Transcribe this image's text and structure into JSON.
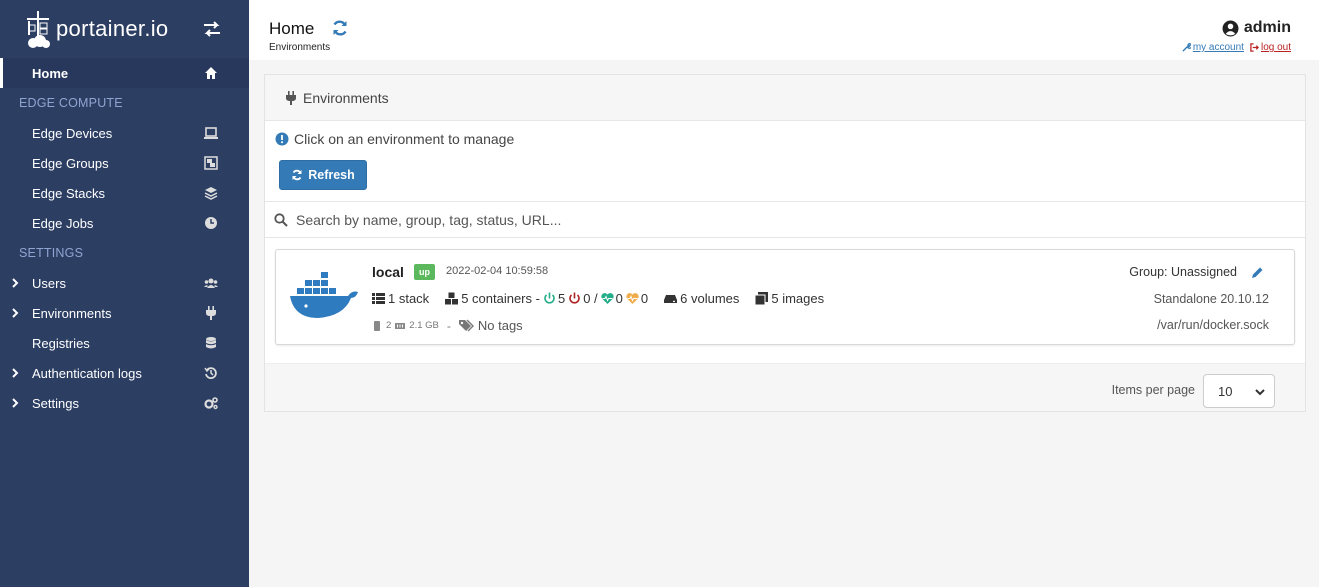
{
  "app": {
    "brand": "portainer.io",
    "accent_color": "#337ab7",
    "sidebar_color": "#2d3e63"
  },
  "sidebar": {
    "home": "Home",
    "edge_header": "EDGE COMPUTE",
    "edge_items": [
      {
        "label": "Edge Devices",
        "icon": "laptop-icon"
      },
      {
        "label": "Edge Groups",
        "icon": "object-group-icon"
      },
      {
        "label": "Edge Stacks",
        "icon": "layers-icon"
      },
      {
        "label": "Edge Jobs",
        "icon": "clock-icon"
      }
    ],
    "settings_header": "SETTINGS",
    "settings_items": [
      {
        "label": "Users",
        "icon": "users-icon",
        "expandable": true
      },
      {
        "label": "Environments",
        "icon": "plug-icon",
        "expandable": true
      },
      {
        "label": "Registries",
        "icon": "database-icon",
        "expandable": false
      },
      {
        "label": "Authentication logs",
        "icon": "history-icon",
        "expandable": true
      },
      {
        "label": "Settings",
        "icon": "cogs-icon",
        "expandable": true
      }
    ]
  },
  "header": {
    "title": "Home",
    "breadcrumb": "Environments",
    "user": "admin",
    "my_account": "my account",
    "log_out": "log out"
  },
  "panel": {
    "title": "Environments",
    "info": "Click on an environment to manage",
    "refresh_label": "Refresh",
    "search_placeholder": "Search by name, group, tag, status, URL..."
  },
  "environment": {
    "name": "local",
    "status": "up",
    "timestamp": "2022-02-04 10:59:58",
    "stacks": "1 stack",
    "containers": "5 containers -",
    "running": "5",
    "stopped": "0 /",
    "healthy": "0",
    "unhealthy": "0",
    "volumes": "6 volumes",
    "images": "5 images",
    "cpu": "2",
    "memory": "2.1 GB",
    "separator": "-",
    "tags": "No tags",
    "group": "Group: Unassigned",
    "version": "Standalone 20.10.12",
    "socket": "/var/run/docker.sock"
  },
  "pagination": {
    "items_per_page_label": "Items per page",
    "items_per_page_value": "10"
  }
}
